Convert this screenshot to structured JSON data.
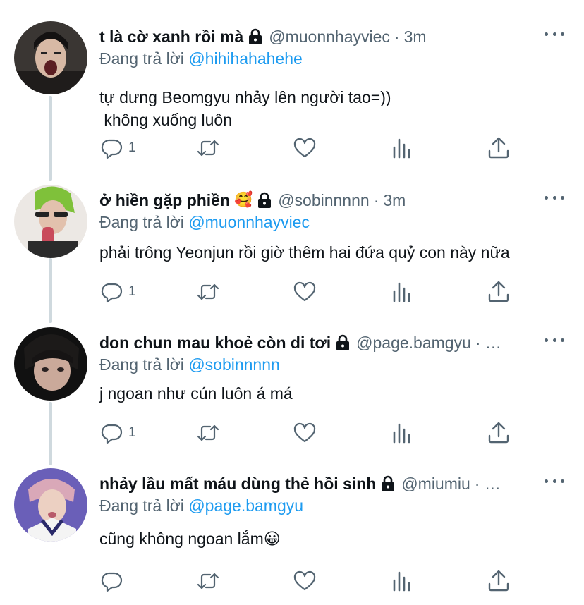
{
  "reply_prefix": "Đang trả lời",
  "tweets": [
    {
      "name": "t là cờ xanh rồi mà",
      "emoji": "",
      "handle": "@muonnhayviec",
      "separator": "·",
      "time": "3m",
      "reply_to": "@hihihahahehe",
      "text": "tự dưng Beomgyu nhảy lên người tao=))\n không xuống luôn",
      "reply_count": "1"
    },
    {
      "name": "ở hiền gặp phiền",
      "emoji": "🥰",
      "handle": "@sobinnnnn",
      "separator": "·",
      "time": "3m",
      "reply_to": "@muonnhayviec",
      "text": "phải trông Yeonjun rồi giờ thêm hai đứa quỷ con này nữa",
      "reply_count": "1"
    },
    {
      "name": "don chun mau khoẻ còn di tơi",
      "emoji": "",
      "handle": "@page.bamgyu",
      "separator": "· …",
      "time": "",
      "reply_to": "@sobinnnnn",
      "text": "j ngoan như cún luôn á má",
      "reply_count": "1"
    },
    {
      "name": "nhảy lầu mất máu dùng thẻ hồi sinh",
      "emoji": "",
      "handle": "@miumiu",
      "separator": "· …",
      "time": "",
      "reply_to": "@page.bamgyu",
      "text": "cũng không ngoan lắm😀",
      "reply_count": ""
    }
  ],
  "icons": {
    "reply": "reply-icon",
    "retweet": "retweet-icon",
    "like": "heart-icon",
    "stats": "bar-chart-icon",
    "share": "share-icon",
    "lock": "lock-icon",
    "more": "more-dots-icon"
  },
  "colors": {
    "link": "#1d9bf0",
    "secondary_text": "#536471",
    "thread_line": "#cfd9de"
  }
}
